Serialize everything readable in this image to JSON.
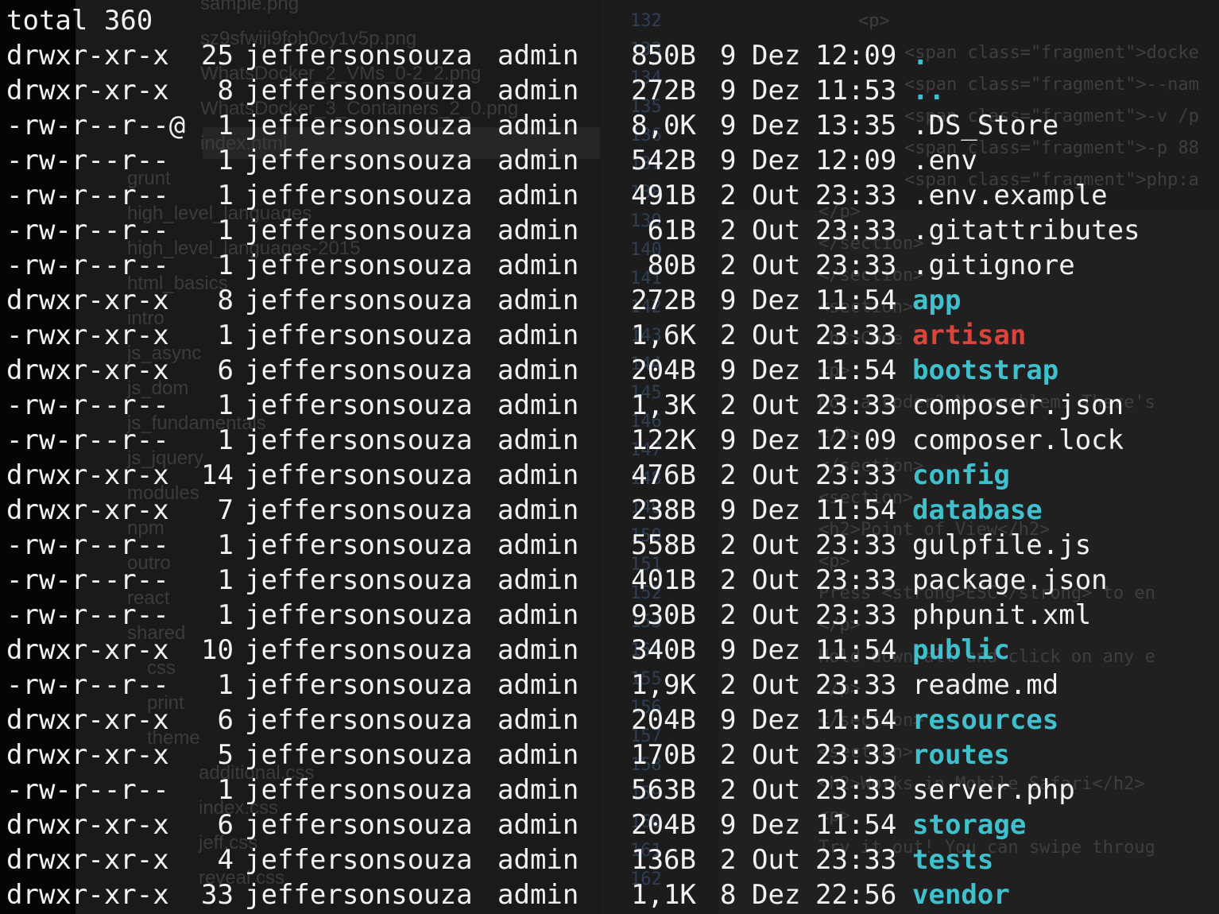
{
  "terminal": {
    "total_line": "total 360",
    "entries": [
      {
        "perm": "drwxr-xr-x",
        "links": "25",
        "owner": "jeffersonsouza",
        "group": "admin",
        "size": "850B",
        "day": "9",
        "month": "Dez",
        "time": "12:09",
        "name": ".",
        "kind": "dir"
      },
      {
        "perm": "drwxr-xr-x",
        "links": "8",
        "owner": "jeffersonsouza",
        "group": "admin",
        "size": "272B",
        "day": "9",
        "month": "Dez",
        "time": "11:53",
        "name": "..",
        "kind": "dir"
      },
      {
        "perm": "-rw-r--r--@",
        "links": "1",
        "owner": "jeffersonsouza",
        "group": "admin",
        "size": "8,0K",
        "day": "9",
        "month": "Dez",
        "time": "13:35",
        "name": ".DS_Store",
        "kind": "file"
      },
      {
        "perm": "-rw-r--r--",
        "links": "1",
        "owner": "jeffersonsouza",
        "group": "admin",
        "size": "542B",
        "day": "9",
        "month": "Dez",
        "time": "12:09",
        "name": ".env",
        "kind": "file"
      },
      {
        "perm": "-rw-r--r--",
        "links": "1",
        "owner": "jeffersonsouza",
        "group": "admin",
        "size": "491B",
        "day": "2",
        "month": "Out",
        "time": "23:33",
        "name": ".env.example",
        "kind": "file"
      },
      {
        "perm": "-rw-r--r--",
        "links": "1",
        "owner": "jeffersonsouza",
        "group": "admin",
        "size": "61B",
        "day": "2",
        "month": "Out",
        "time": "23:33",
        "name": ".gitattributes",
        "kind": "file"
      },
      {
        "perm": "-rw-r--r--",
        "links": "1",
        "owner": "jeffersonsouza",
        "group": "admin",
        "size": "80B",
        "day": "2",
        "month": "Out",
        "time": "23:33",
        "name": ".gitignore",
        "kind": "file"
      },
      {
        "perm": "drwxr-xr-x",
        "links": "8",
        "owner": "jeffersonsouza",
        "group": "admin",
        "size": "272B",
        "day": "9",
        "month": "Dez",
        "time": "11:54",
        "name": "app",
        "kind": "dir"
      },
      {
        "perm": "-rwxr-xr-x",
        "links": "1",
        "owner": "jeffersonsouza",
        "group": "admin",
        "size": "1,6K",
        "day": "2",
        "month": "Out",
        "time": "23:33",
        "name": "artisan",
        "kind": "exec"
      },
      {
        "perm": "drwxr-xr-x",
        "links": "6",
        "owner": "jeffersonsouza",
        "group": "admin",
        "size": "204B",
        "day": "9",
        "month": "Dez",
        "time": "11:54",
        "name": "bootstrap",
        "kind": "dir"
      },
      {
        "perm": "-rw-r--r--",
        "links": "1",
        "owner": "jeffersonsouza",
        "group": "admin",
        "size": "1,3K",
        "day": "2",
        "month": "Out",
        "time": "23:33",
        "name": "composer.json",
        "kind": "file"
      },
      {
        "perm": "-rw-r--r--",
        "links": "1",
        "owner": "jeffersonsouza",
        "group": "admin",
        "size": "122K",
        "day": "9",
        "month": "Dez",
        "time": "12:09",
        "name": "composer.lock",
        "kind": "file"
      },
      {
        "perm": "drwxr-xr-x",
        "links": "14",
        "owner": "jeffersonsouza",
        "group": "admin",
        "size": "476B",
        "day": "2",
        "month": "Out",
        "time": "23:33",
        "name": "config",
        "kind": "dir"
      },
      {
        "perm": "drwxr-xr-x",
        "links": "7",
        "owner": "jeffersonsouza",
        "group": "admin",
        "size": "238B",
        "day": "9",
        "month": "Dez",
        "time": "11:54",
        "name": "database",
        "kind": "dir"
      },
      {
        "perm": "-rw-r--r--",
        "links": "1",
        "owner": "jeffersonsouza",
        "group": "admin",
        "size": "558B",
        "day": "2",
        "month": "Out",
        "time": "23:33",
        "name": "gulpfile.js",
        "kind": "file"
      },
      {
        "perm": "-rw-r--r--",
        "links": "1",
        "owner": "jeffersonsouza",
        "group": "admin",
        "size": "401B",
        "day": "2",
        "month": "Out",
        "time": "23:33",
        "name": "package.json",
        "kind": "file"
      },
      {
        "perm": "-rw-r--r--",
        "links": "1",
        "owner": "jeffersonsouza",
        "group": "admin",
        "size": "930B",
        "day": "2",
        "month": "Out",
        "time": "23:33",
        "name": "phpunit.xml",
        "kind": "file"
      },
      {
        "perm": "drwxr-xr-x",
        "links": "10",
        "owner": "jeffersonsouza",
        "group": "admin",
        "size": "340B",
        "day": "9",
        "month": "Dez",
        "time": "11:54",
        "name": "public",
        "kind": "dir"
      },
      {
        "perm": "-rw-r--r--",
        "links": "1",
        "owner": "jeffersonsouza",
        "group": "admin",
        "size": "1,9K",
        "day": "2",
        "month": "Out",
        "time": "23:33",
        "name": "readme.md",
        "kind": "file"
      },
      {
        "perm": "drwxr-xr-x",
        "links": "6",
        "owner": "jeffersonsouza",
        "group": "admin",
        "size": "204B",
        "day": "9",
        "month": "Dez",
        "time": "11:54",
        "name": "resources",
        "kind": "dir"
      },
      {
        "perm": "drwxr-xr-x",
        "links": "5",
        "owner": "jeffersonsouza",
        "group": "admin",
        "size": "170B",
        "day": "2",
        "month": "Out",
        "time": "23:33",
        "name": "routes",
        "kind": "dir"
      },
      {
        "perm": "-rw-r--r--",
        "links": "1",
        "owner": "jeffersonsouza",
        "group": "admin",
        "size": "563B",
        "day": "2",
        "month": "Out",
        "time": "23:33",
        "name": "server.php",
        "kind": "file"
      },
      {
        "perm": "drwxr-xr-x",
        "links": "6",
        "owner": "jeffersonsouza",
        "group": "admin",
        "size": "204B",
        "day": "9",
        "month": "Dez",
        "time": "11:54",
        "name": "storage",
        "kind": "dir"
      },
      {
        "perm": "drwxr-xr-x",
        "links": "4",
        "owner": "jeffersonsouza",
        "group": "admin",
        "size": "136B",
        "day": "2",
        "month": "Out",
        "time": "23:33",
        "name": "tests",
        "kind": "dir"
      },
      {
        "perm": "drwxr-xr-x",
        "links": "33",
        "owner": "jeffersonsouza",
        "group": "admin",
        "size": "1,1K",
        "day": "8",
        "month": "Dez",
        "time": "22:56",
        "name": "vendor",
        "kind": "dir"
      }
    ]
  },
  "colors": {
    "dir": "#3fc0cd",
    "exec": "#d9453b",
    "file": "#f2f2f2",
    "background": "#0b0b0b"
  },
  "background_editor": {
    "tree_items": [
      "sample.png",
      "sz9sfwiji9foh0cy1v5p.png",
      "WhatsDocker_2_VMs_0-2_2.png",
      "WhatsDocker_3_Containers_2_0.png",
      "index.html",
      "grunt",
      "high_level_languages",
      "high_level_languages-2015",
      "html_basics",
      "intro",
      "js_async",
      "js_dom",
      "js_fundamentals",
      "js_jquery",
      "modules",
      "npm",
      "outro",
      "react",
      "shared",
      "css",
      "print",
      "theme",
      "additional.css",
      "index.css",
      "jeff.css",
      "reveal.css"
    ],
    "line_numbers": [
      "132",
      "133",
      "134",
      "135",
      "136",
      "137",
      "138",
      "139",
      "140",
      "141",
      "142",
      "143",
      "144",
      "145",
      "146",
      "147",
      "148",
      "149",
      "150",
      "151",
      "152",
      "153",
      "154",
      "155",
      "156",
      "157",
      "158",
      "159",
      "160",
      "161",
      "162"
    ],
    "code_lines": [
      "<p>",
      "<span class=\"fragment\">docke",
      "<span class=\"fragment\">--nam",
      "<span class=\"fragment\">-v /p",
      "<span class=\"fragment\">-p 88",
      "<span class=\"fragment\">php:a",
      "</p>",
      "</section>",
      "</section>",
      "<section>",
      "<h2>Code",
      "<p>",
      "Not a coder? No problem. There's",
      "</p>",
      "</section>",
      "<section>",
      "<h2>Point of View</h2>",
      "<p>",
      "Press <strong>ESC</strong> to en",
      "</p>",
      "Hold down alt and click on any e",
      "</p>",
      "</section>",
      "<section>",
      "<h2>Works in Mobile Safari</h2>",
      "<p>",
      "Try it out! You can swipe throug"
    ]
  }
}
